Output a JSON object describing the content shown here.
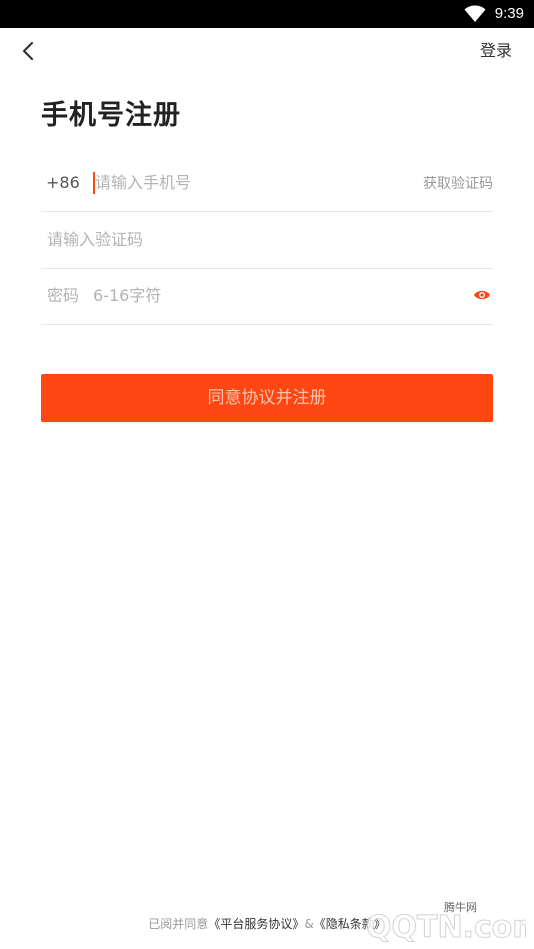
{
  "status_bar": {
    "time": "9:39",
    "wifi_icon": "wifi-icon"
  },
  "nav": {
    "back_icon": "chevron-left-icon",
    "login_label": "登录"
  },
  "title": "手机号注册",
  "form": {
    "country_code": "+86",
    "phone_placeholder": "请输入手机号",
    "get_code_label": "获取验证码",
    "code_placeholder": "请输入验证码",
    "password_label": "密码",
    "password_placeholder": "6-16字符",
    "eye_icon": "eye-icon"
  },
  "submit_label": "同意协议并注册",
  "agreement": {
    "prefix": "已阅并同意",
    "service_link": "《平台服务协议》",
    "separator": "&",
    "privacy_link": "《隐私条款》"
  },
  "watermark": {
    "site_name": "腾牛网",
    "domain": "QQTN.com"
  },
  "colors": {
    "accent": "#ff4713",
    "button_text": "#ffc3ad",
    "placeholder": "#b3b3b3"
  }
}
